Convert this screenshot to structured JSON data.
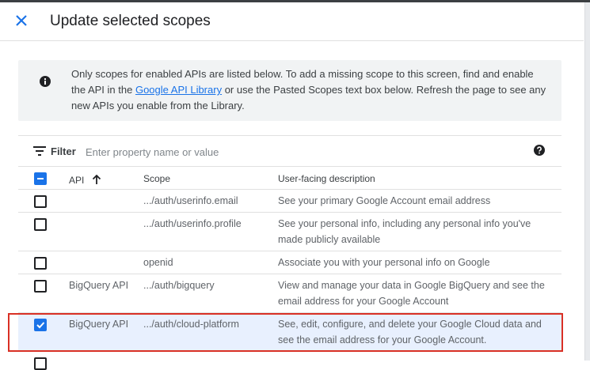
{
  "dialog": {
    "title": "Update selected scopes"
  },
  "info": {
    "text_before": "Only scopes for enabled APIs are listed below. To add a missing scope to this screen, find and enable the API in the ",
    "link": "Google API Library",
    "text_after": " or use the Pasted Scopes text box below. Refresh the page to see any new APIs you enable from the Library."
  },
  "filter": {
    "label": "Filter",
    "placeholder": "Enter property name or value"
  },
  "table": {
    "headers": {
      "api": "API",
      "scope": "Scope",
      "description": "User-facing description"
    },
    "rows": [
      {
        "api": "",
        "scope": ".../auth/userinfo.email",
        "description": "See your primary Google Account email address",
        "checked": false
      },
      {
        "api": "",
        "scope": ".../auth/userinfo.profile",
        "description": "See your personal info, including any personal info you've made publicly available",
        "checked": false
      },
      {
        "api": "",
        "scope": "openid",
        "description": "Associate you with your personal info on Google",
        "checked": false
      },
      {
        "api": "BigQuery API",
        "scope": ".../auth/bigquery",
        "description": "View and manage your data in Google BigQuery and see the email address for your Google Account",
        "checked": false
      },
      {
        "api": "BigQuery API",
        "scope": ".../auth/cloud-platform",
        "description": "See, edit, configure, and delete your Google Cloud data and see the email address for your Google Account.",
        "checked": true
      }
    ]
  },
  "colors": {
    "accent": "#1a73e8",
    "highlight": "#d93025",
    "selected_row": "#e8f0fe"
  }
}
